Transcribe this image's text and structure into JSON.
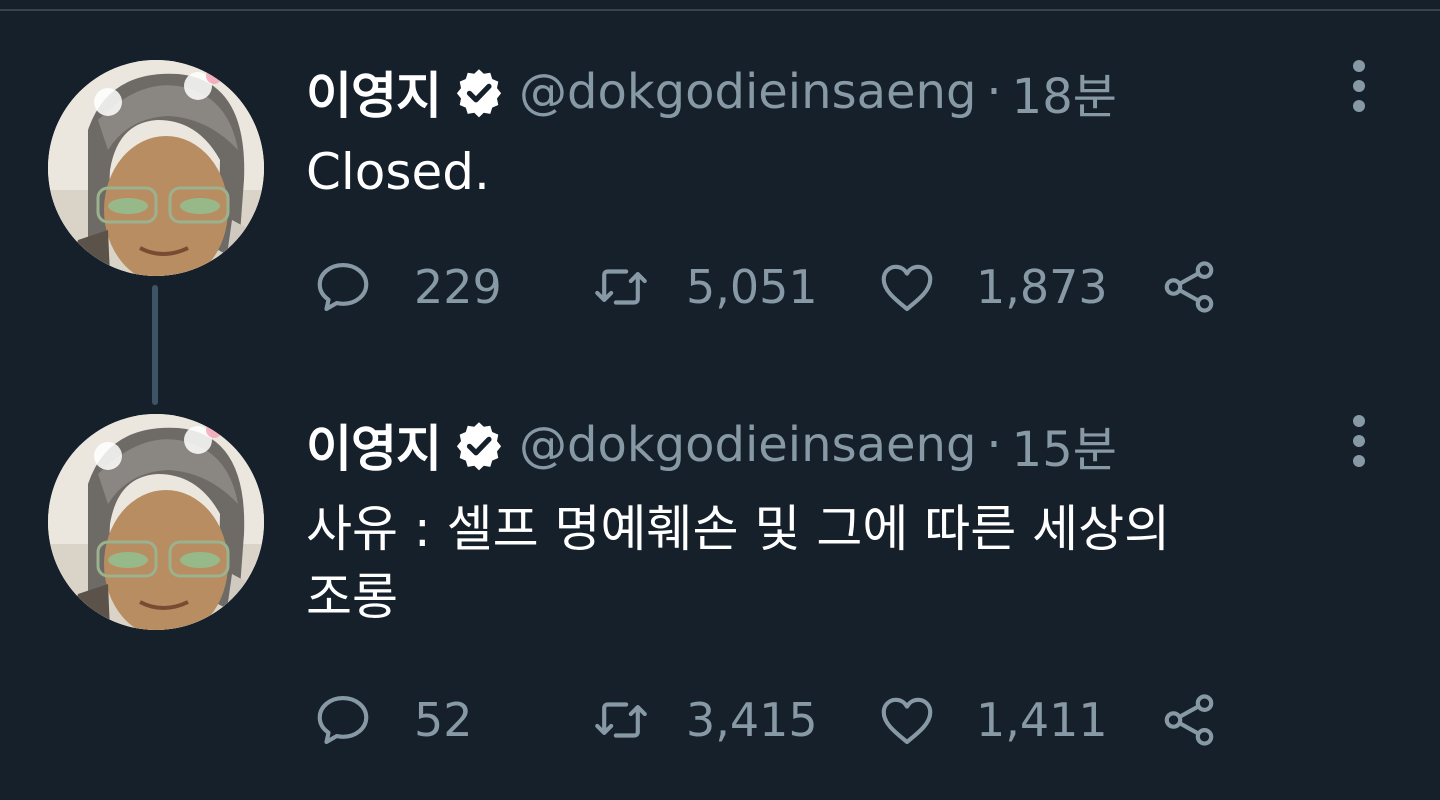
{
  "tweets": [
    {
      "display_name": "이영지",
      "handle": "@dokgodieinsaeng",
      "separator": "·",
      "time": "18분",
      "text": "Closed.",
      "replies": "229",
      "retweets": "5,051",
      "likes": "1,873"
    },
    {
      "display_name": "이영지",
      "handle": "@dokgodieinsaeng",
      "separator": "·",
      "time": "15분",
      "text": "사유 : 셀프 명예훼손 및 그에 따른 세상의\n조롱",
      "replies": "52",
      "retweets": "3,415",
      "likes": "1,411"
    }
  ],
  "icons": {
    "verified": "verified-badge-icon",
    "more": "more-vertical-icon",
    "reply": "reply-icon",
    "retweet": "retweet-icon",
    "like": "heart-icon",
    "share": "share-icon"
  },
  "colors": {
    "background": "#15202b",
    "primary_text": "#ffffff",
    "secondary_text": "#8899a6",
    "thread_line": "#3d5466",
    "divider": "#38444d"
  }
}
